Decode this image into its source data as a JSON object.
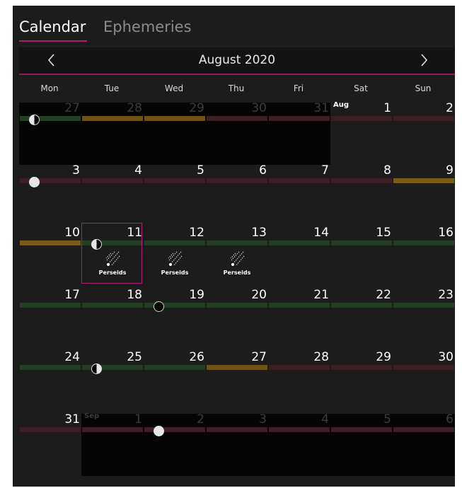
{
  "tabs": [
    {
      "label": "Calendar",
      "active": true
    },
    {
      "label": "Ephemeries",
      "active": false
    }
  ],
  "month_title": "August 2020",
  "nav": {
    "prev_icon": "chevron-left-icon",
    "next_icon": "chevron-right-icon"
  },
  "weekdays": [
    "Mon",
    "Tue",
    "Wed",
    "Thu",
    "Fri",
    "Sat",
    "Sun"
  ],
  "colors": {
    "accent": "#b01d79",
    "bar_green": "#263d26",
    "bar_red": "#3c1f22",
    "bar_orange": "#6d5316",
    "bar_amber": "#7a5c18"
  },
  "weeks": [
    {
      "days": [
        {
          "n": "27",
          "other": true,
          "bar": "green",
          "moon": "last"
        },
        {
          "n": "28",
          "other": true,
          "bar": "orange"
        },
        {
          "n": "29",
          "other": true,
          "bar": "orange"
        },
        {
          "n": "30",
          "other": true,
          "bar": "red"
        },
        {
          "n": "31",
          "other": true,
          "bar": "red"
        },
        {
          "n": "1",
          "month_label": "Aug",
          "bar": "red"
        },
        {
          "n": "2",
          "bar": "red"
        }
      ]
    },
    {
      "days": [
        {
          "n": "3",
          "bar": "red",
          "moon": "full"
        },
        {
          "n": "4",
          "bar": "red"
        },
        {
          "n": "5",
          "bar": "red"
        },
        {
          "n": "6",
          "bar": "red"
        },
        {
          "n": "7",
          "bar": "red"
        },
        {
          "n": "8",
          "bar": "red"
        },
        {
          "n": "9",
          "bar": "amber"
        }
      ]
    },
    {
      "days": [
        {
          "n": "10",
          "bar": "amber"
        },
        {
          "n": "11",
          "bar": "green",
          "moon": "last",
          "event": "Perseids",
          "selected": true
        },
        {
          "n": "12",
          "bar": "green",
          "event": "Perseids"
        },
        {
          "n": "13",
          "bar": "green",
          "event": "Perseids"
        },
        {
          "n": "14",
          "bar": "green"
        },
        {
          "n": "15",
          "bar": "green"
        },
        {
          "n": "16",
          "bar": "green"
        }
      ]
    },
    {
      "days": [
        {
          "n": "17",
          "bar": "green"
        },
        {
          "n": "18",
          "bar": "green"
        },
        {
          "n": "19",
          "bar": "green",
          "moon": "new"
        },
        {
          "n": "20",
          "bar": "green"
        },
        {
          "n": "21",
          "bar": "green"
        },
        {
          "n": "22",
          "bar": "green"
        },
        {
          "n": "23",
          "bar": "green"
        }
      ]
    },
    {
      "days": [
        {
          "n": "24",
          "bar": "green"
        },
        {
          "n": "25",
          "bar": "green",
          "moon": "first"
        },
        {
          "n": "26",
          "bar": "green"
        },
        {
          "n": "27",
          "bar": "orange"
        },
        {
          "n": "28",
          "bar": "red"
        },
        {
          "n": "29",
          "bar": "red"
        },
        {
          "n": "30",
          "bar": "red"
        }
      ]
    },
    {
      "days": [
        {
          "n": "31",
          "bar": "red"
        },
        {
          "n": "1",
          "other": true,
          "month_label": "Sep",
          "bar": "red"
        },
        {
          "n": "2",
          "other": true,
          "bar": "red",
          "moon": "full"
        },
        {
          "n": "3",
          "other": true,
          "bar": "red"
        },
        {
          "n": "4",
          "other": true,
          "bar": "red"
        },
        {
          "n": "5",
          "other": true,
          "bar": "red"
        },
        {
          "n": "6",
          "other": true,
          "bar": "red"
        }
      ]
    }
  ]
}
